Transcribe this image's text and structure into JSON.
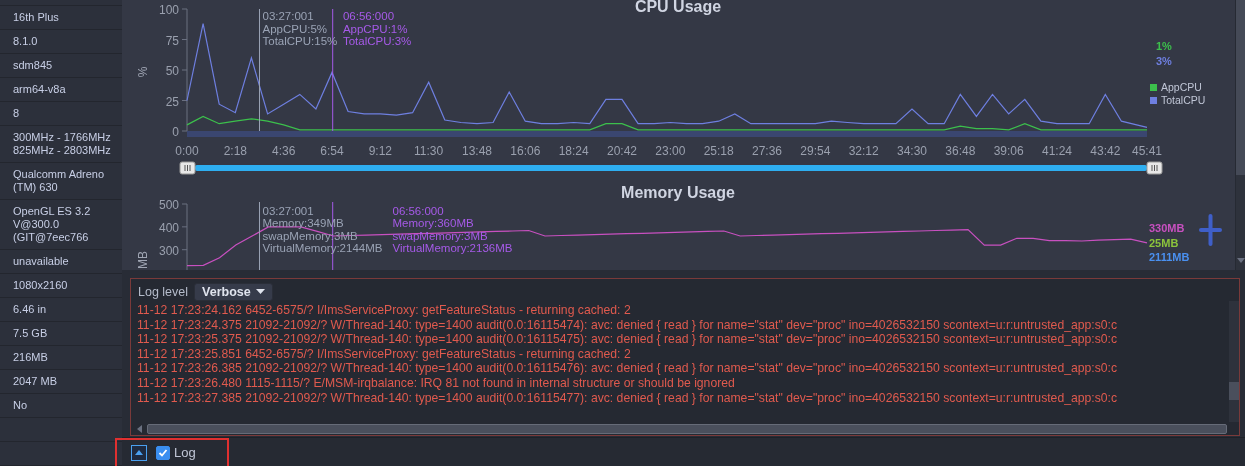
{
  "device_info": [
    {
      "value": "16th Plus"
    },
    {
      "value": "8.1.0"
    },
    {
      "value": "sdm845"
    },
    {
      "value": "arm64-v8a"
    },
    {
      "value": "8"
    },
    {
      "value": "300MHz - 1766MHz\n825MHz - 2803MHz"
    },
    {
      "value": "Qualcomm Adreno\n(TM) 630"
    },
    {
      "value": "OpenGL ES 3.2\nV@300.0\n(GIT@7eec766"
    },
    {
      "value": "unavailable"
    },
    {
      "value": "1080x2160"
    },
    {
      "value": "6.46 in"
    },
    {
      "value": "7.5 GB"
    },
    {
      "value": "216MB"
    },
    {
      "value": "2047 MB"
    },
    {
      "value": "No"
    }
  ],
  "cpu_chart": {
    "title": "CPU Usage",
    "cursor_readouts": [
      {
        "color": "#9aa3b5",
        "lines": [
          "03:27:001",
          "AppCPU:5%",
          "TotalCPU:15%"
        ]
      },
      {
        "color": "#a65ae8",
        "lines": [
          "06:56:000",
          "AppCPU:1%",
          "TotalCPU:3%"
        ]
      }
    ],
    "end_values": [
      {
        "text": "1%",
        "color": "#3cc04c"
      },
      {
        "text": "3%",
        "color": "#6e7fe0"
      }
    ],
    "chart_data": {
      "type": "line",
      "ylabel": "%",
      "xlim": [
        0,
        2741
      ],
      "ylim": [
        0,
        100
      ],
      "legend": "right",
      "x": [
        0,
        46,
        92,
        138,
        184,
        230,
        276,
        322,
        368,
        414,
        460,
        506,
        552,
        598,
        644,
        690,
        736,
        782,
        828,
        874,
        920,
        966,
        1012,
        1058,
        1104,
        1150,
        1196,
        1242,
        1288,
        1334,
        1380,
        1426,
        1472,
        1518,
        1564,
        1610,
        1656,
        1702,
        1748,
        1794,
        1840,
        1886,
        1932,
        1978,
        2024,
        2070,
        2116,
        2162,
        2208,
        2254,
        2300,
        2346,
        2392,
        2438,
        2484,
        2530,
        2576,
        2622,
        2668,
        2741
      ],
      "series": [
        {
          "name": "AppCPU",
          "color": "#3cc04c",
          "values": [
            5,
            12,
            6,
            8,
            10,
            8,
            5,
            1,
            1,
            1,
            1,
            1,
            1,
            1,
            1,
            1,
            1,
            1,
            1,
            1,
            1,
            1,
            1,
            1,
            1,
            1,
            6,
            6,
            1,
            1,
            1,
            1,
            1,
            1,
            1,
            1,
            1,
            1,
            1,
            1,
            1,
            1,
            1,
            1,
            1,
            1,
            1,
            1,
            4,
            2,
            2,
            1,
            6,
            1,
            1,
            1,
            1,
            1,
            1,
            1
          ]
        },
        {
          "name": "TotalCPU",
          "color": "#6e7fe0",
          "values": [
            25,
            88,
            22,
            15,
            60,
            14,
            22,
            30,
            18,
            48,
            16,
            14,
            14,
            13,
            15,
            40,
            9,
            7,
            6,
            7,
            32,
            8,
            6,
            6,
            7,
            6,
            26,
            26,
            6,
            6,
            7,
            6,
            6,
            8,
            14,
            6,
            6,
            6,
            6,
            6,
            8,
            7,
            6,
            6,
            6,
            18,
            6,
            6,
            30,
            12,
            30,
            14,
            26,
            8,
            6,
            6,
            6,
            30,
            8,
            3
          ]
        }
      ],
      "yticks": [
        0,
        25,
        50,
        75,
        100
      ],
      "xticks": [
        {
          "value": 0,
          "label": "0:00"
        },
        {
          "value": 138,
          "label": "2:18"
        },
        {
          "value": 276,
          "label": "4:36"
        },
        {
          "value": 414,
          "label": "6:54"
        },
        {
          "value": 552,
          "label": "9:12"
        },
        {
          "value": 690,
          "label": "11:30"
        },
        {
          "value": 828,
          "label": "13:48"
        },
        {
          "value": 966,
          "label": "16:06"
        },
        {
          "value": 1104,
          "label": "18:24"
        },
        {
          "value": 1242,
          "label": "20:42"
        },
        {
          "value": 1380,
          "label": "23:00"
        },
        {
          "value": 1518,
          "label": "25:18"
        },
        {
          "value": 1656,
          "label": "27:36"
        },
        {
          "value": 1794,
          "label": "29:54"
        },
        {
          "value": 1932,
          "label": "32:12"
        },
        {
          "value": 2070,
          "label": "34:30"
        },
        {
          "value": 2208,
          "label": "36:48"
        },
        {
          "value": 2346,
          "label": "39:06"
        },
        {
          "value": 2484,
          "label": "41:24"
        },
        {
          "value": 2622,
          "label": "43:42"
        },
        {
          "value": 2741,
          "label": "45:41"
        }
      ],
      "ref_lines": [
        {
          "axis": "x",
          "value": 207,
          "color": "#9aa3b5"
        },
        {
          "axis": "x",
          "value": 416,
          "color": "#a65ae8"
        }
      ]
    }
  },
  "memory_chart": {
    "title": "Memory Usage",
    "cursor_readouts": [
      {
        "color": "#9aa3b5",
        "lines": [
          "03:27:001",
          "Memory:349MB",
          "swapMemory:3MB",
          "VirtualMemory:2144MB"
        ]
      },
      {
        "color": "#a65ae8",
        "lines": [
          "06:56:000",
          "Memory:360MB",
          "swapMemory:3MB",
          "VirtualMemory:2136MB"
        ]
      }
    ],
    "end_values": [
      {
        "text": "330MB",
        "color": "#c850c0"
      },
      {
        "text": "25MB",
        "color": "#8cc43c"
      },
      {
        "text": "2111MB",
        "color": "#4a90f0"
      }
    ],
    "chart_data": {
      "type": "line",
      "ylabel": "MB",
      "ylim": [
        220,
        500
      ],
      "series": [
        {
          "color": "#c850c0",
          "values": [
            230,
            232,
            265,
            320,
            360,
            400,
            400,
            400,
            380,
            360,
            362,
            364,
            366,
            368,
            370,
            372,
            374,
            376,
            378,
            380,
            382,
            384,
            360,
            362,
            364,
            366,
            368,
            370,
            372,
            374,
            376,
            378,
            380,
            382,
            360,
            362,
            364,
            366,
            368,
            370,
            372,
            374,
            376,
            378,
            380,
            382,
            384,
            386,
            388,
            320,
            320,
            350,
            350,
            340,
            340,
            338,
            342,
            344,
            346,
            330
          ]
        }
      ],
      "yticks": [
        300,
        400,
        500
      ]
    }
  },
  "log_panel": {
    "label": "Log level",
    "level": "Verbose",
    "lines": [
      "11-12 17:23:24.162 6452-6575/? I/ImsServiceProxy: getFeatureStatus - returning cached: 2",
      "11-12 17:23:24.375 21092-21092/? W/Thread-140: type=1400 audit(0.0:16115474): avc: denied { read } for name=\"stat\" dev=\"proc\" ino=4026532150 scontext=u:r:untrusted_app:s0:c",
      "11-12 17:23:25.375 21092-21092/? W/Thread-140: type=1400 audit(0.0:16115475): avc: denied { read } for name=\"stat\" dev=\"proc\" ino=4026532150 scontext=u:r:untrusted_app:s0:c",
      "11-12 17:23:25.851 6452-6575/? I/ImsServiceProxy: getFeatureStatus - returning cached: 2",
      "11-12 17:23:26.385 21092-21092/? W/Thread-140: type=1400 audit(0.0:16115476): avc: denied { read } for name=\"stat\" dev=\"proc\" ino=4026532150 scontext=u:r:untrusted_app:s0:c",
      "11-12 17:23:26.480 1115-1115/? E/MSM-irqbalance: IRQ 81 not found in internal structure or should be ignored",
      "11-12 17:23:27.385 21092-21092/? W/Thread-140: type=1400 audit(0.0:16115477): avc: denied { read } for name=\"stat\" dev=\"proc\" ino=4026532150 scontext=u:r:untrusted_app:s0:c"
    ]
  },
  "bottom_bar": {
    "log_toggle": {
      "label": "Log",
      "checked": true
    }
  }
}
